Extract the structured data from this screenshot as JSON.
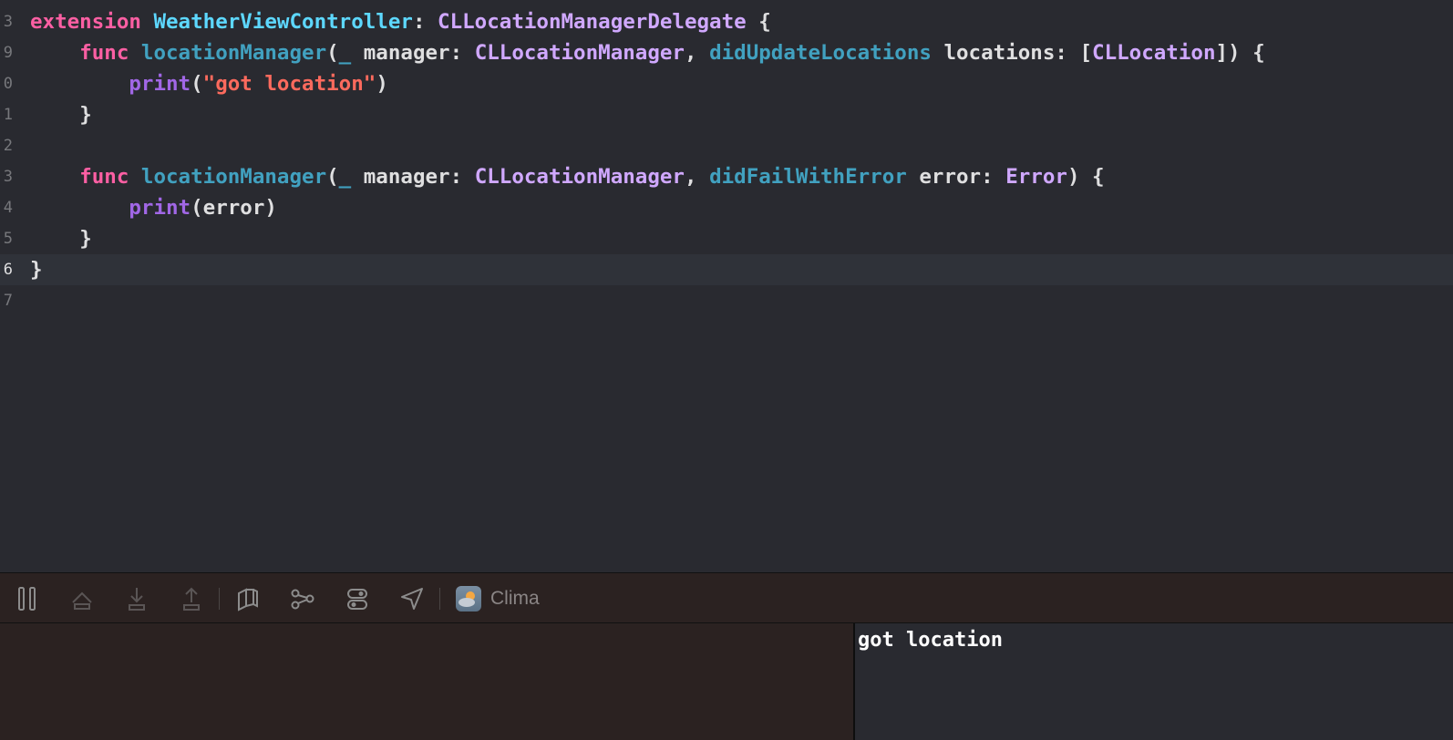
{
  "editor": {
    "line_numbers": [
      "3",
      "9",
      "0",
      "1",
      "2",
      "3",
      "4",
      "5",
      "6",
      "7"
    ],
    "tokens": {
      "extension": "extension",
      "class_name": "WeatherViewController",
      "colon_space": ": ",
      "protocol": "CLLocationManagerDelegate",
      "open_brace": " {",
      "func": "func",
      "location_manager": "locationManager",
      "open_paren": "(",
      "underscore": "_",
      "manager_param": " manager: ",
      "manager_type": "CLLocationManager",
      "comma": ", ",
      "did_update_locations": "didUpdateLocations",
      "locations_param": " locations: [",
      "cllocation_type": "CLLocation",
      "locations_close": "]) {",
      "print": "print",
      "got_location_string": "\"got location\"",
      "close_paren": ")",
      "close_brace": "}",
      "did_fail_with_error": "didFailWithError",
      "error_param": " error: ",
      "error_type": "Error",
      "error_close": ") {",
      "error_arg": "(error)"
    }
  },
  "debug_bar": {
    "icons": [
      "pause-icon",
      "step-over-icon",
      "step-into-icon",
      "step-out-icon",
      "view-hierarchy-icon",
      "memory-graph-icon",
      "environment-overrides-icon",
      "location-icon"
    ],
    "scheme_name": "Clima"
  },
  "console": {
    "output": "got location"
  },
  "colors": {
    "keyword": "#fc5fa3",
    "type_declaration": "#5dd8ff",
    "type": "#d0a8ff",
    "function": "#41a1c0",
    "string": "#fc6a5d",
    "call": "#a167e6",
    "editor_background": "#292a30",
    "debug_bar_background": "#2b2221"
  }
}
